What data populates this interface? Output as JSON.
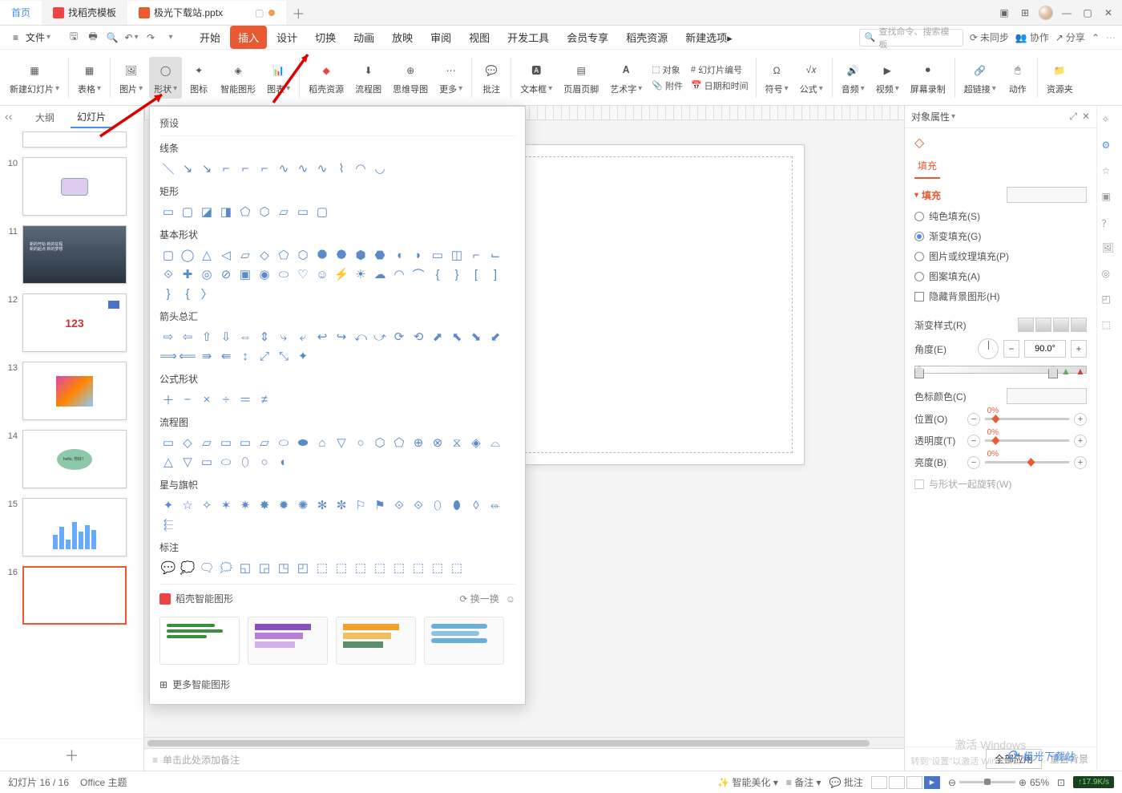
{
  "app": {
    "tabs": {
      "home": "首页",
      "template": "找稻壳模板",
      "doc": "极光下载站.pptx"
    }
  },
  "menubar": {
    "file": "文件",
    "tabs": [
      "开始",
      "插入",
      "设计",
      "切换",
      "动画",
      "放映",
      "审阅",
      "视图",
      "开发工具",
      "会员专享",
      "稻壳资源",
      "新建选项"
    ],
    "search_placeholder": "查找命令、搜索模板",
    "right": {
      "unsync": "未同步",
      "coop": "协作",
      "share": "分享"
    }
  },
  "ribbon": {
    "new_slide": "新建幻灯片",
    "table": "表格",
    "picture": "图片",
    "shapes": "形状",
    "icons": "图标",
    "smartart": "智能图形",
    "chart": "图表",
    "dk_res": "稻壳资源",
    "flowchart": "流程图",
    "mindmap": "思维导图",
    "more": "更多",
    "comment": "批注",
    "textbox": "文本框",
    "header_footer": "页眉页脚",
    "wordart": "艺术字",
    "object": "对象",
    "slide_number": "幻灯片编号",
    "attach": "附件",
    "datetime": "日期和时间",
    "symbol": "符号",
    "formula": "公式",
    "audio": "音频",
    "video": "视频",
    "screen_rec": "屏幕录制",
    "hyperlink": "超链接",
    "action": "动作",
    "resource": "资源夹"
  },
  "slide_panel": {
    "collapse": "‹‹",
    "outline_tab": "大纲",
    "slides_tab": "幻灯片",
    "slides": [
      {
        "n": "",
        "label": ""
      },
      {
        "n": "10",
        "label": ""
      },
      {
        "n": "11",
        "label": ""
      },
      {
        "n": "12",
        "label": "123"
      },
      {
        "n": "13",
        "label": ""
      },
      {
        "n": "14",
        "label": "hello, 你好！"
      },
      {
        "n": "15",
        "label": ""
      },
      {
        "n": "16",
        "label": ""
      }
    ]
  },
  "shape_dropdown": {
    "header": "预设",
    "sections": {
      "lines": "线条",
      "rects": "矩形",
      "basic": "基本形状",
      "arrows": "箭头总汇",
      "equation": "公式形状",
      "flow": "流程图",
      "stars": "星与旗帜",
      "callouts": "标注"
    },
    "smart_header": "稻壳智能图形",
    "refresh": "换一换",
    "more": "更多智能图形"
  },
  "right_panel": {
    "title": "对象属性",
    "icon_tab": "填充",
    "section": "填充",
    "fills": {
      "solid": "纯色填充(S)",
      "gradient": "渐变填充(G)",
      "picture": "图片或纹理填充(P)",
      "pattern": "图案填充(A)",
      "hide_bg": "隐藏背景图形(H)"
    },
    "grad_style": "渐变样式(R)",
    "angle": "角度(E)",
    "angle_val": "90.0°",
    "stop_color": "色标颜色(C)",
    "position": "位置(O)",
    "position_val": "0%",
    "transparency": "透明度(T)",
    "transparency_val": "0%",
    "brightness": "亮度(B)",
    "brightness_val": "0%",
    "rotate_with_shape": "与形状一起旋转(W)",
    "apply_all": "全部应用",
    "reset_bg": "重置背景"
  },
  "notes_placeholder": "单击此处添加备注",
  "status": {
    "slide": "幻灯片 16 / 16",
    "theme": "Office 主题",
    "beautify": "智能美化",
    "notes": "备注",
    "comments": "批注",
    "zoom": "65%",
    "net": "17.9K/s"
  },
  "watermark": {
    "l1": "激活 Windows",
    "l2": "转到\"设置\"以激活 Windows。",
    "logo": "极光下载站"
  }
}
